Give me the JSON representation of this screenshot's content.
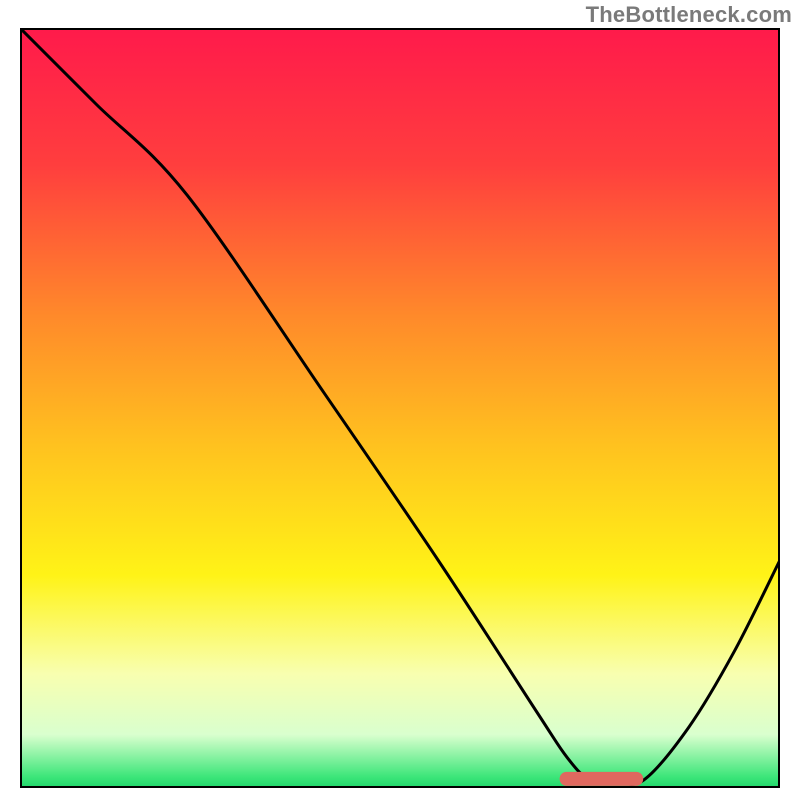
{
  "watermark": "TheBottleneck.com",
  "chart_data": {
    "type": "line",
    "title": "",
    "xlabel": "",
    "ylabel": "",
    "xlim": [
      0,
      100
    ],
    "ylim": [
      0,
      100
    ],
    "grid": false,
    "legend": false,
    "gradient_stops": [
      {
        "offset": 0.0,
        "color": "#ff1a4b"
      },
      {
        "offset": 0.18,
        "color": "#ff3e3e"
      },
      {
        "offset": 0.38,
        "color": "#ff8a2a"
      },
      {
        "offset": 0.55,
        "color": "#ffc21f"
      },
      {
        "offset": 0.72,
        "color": "#fff317"
      },
      {
        "offset": 0.85,
        "color": "#f8ffb0"
      },
      {
        "offset": 0.93,
        "color": "#d9ffce"
      },
      {
        "offset": 0.985,
        "color": "#3de67a"
      },
      {
        "offset": 1.0,
        "color": "#1fd66a"
      }
    ],
    "series": [
      {
        "name": "bottleneck-curve",
        "x": [
          0,
          10,
          22,
          40,
          55,
          68,
          72,
          75,
          78,
          82,
          88,
          94,
          100
        ],
        "values": [
          100,
          90,
          78,
          52,
          30,
          10,
          4,
          1,
          1,
          1,
          8,
          18,
          30
        ]
      }
    ],
    "marker": {
      "name": "optimal-range",
      "x_start": 71,
      "x_end": 82,
      "y": 1.2,
      "color": "#e0685f"
    }
  }
}
